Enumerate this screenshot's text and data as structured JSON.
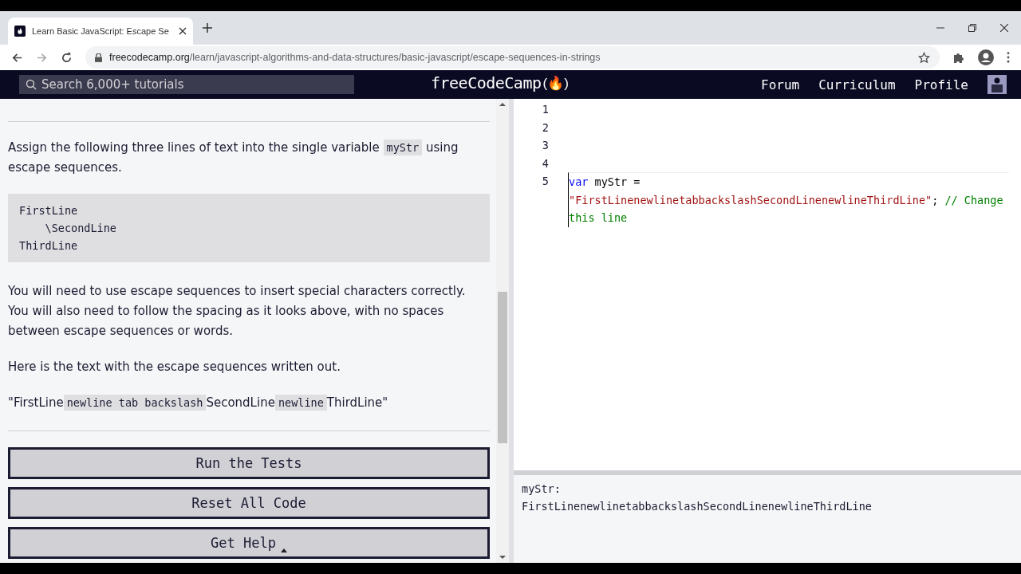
{
  "browser": {
    "tab_title": "Learn Basic JavaScript: Escape Se",
    "url_host": "freecodecamp.org",
    "url_path": "/learn/javascript-algorithms-and-data-structures/basic-javascript/escape-sequences-in-strings"
  },
  "navbar": {
    "search": {
      "placeholder": "Search 6,000+ tutorials"
    },
    "logo": "freeCodeCamp",
    "logo_mark": "(🔥)",
    "links": [
      "Forum",
      "Curriculum",
      "Profile"
    ]
  },
  "lesson": {
    "paragraphs": [
      {
        "kind": "text",
        "parts": [
          {
            "kind": "text",
            "text": "Assign the following three lines of text into the single variable "
          },
          {
            "kind": "code",
            "text": "myStr"
          },
          {
            "kind": "text",
            "text": " using escape sequences."
          }
        ]
      },
      {
        "kind": "pre",
        "lines": [
          "FirstLine",
          "    \\SecondLine",
          "ThirdLine"
        ]
      },
      {
        "kind": "text",
        "parts": [
          {
            "kind": "text",
            "text": "You will need to use escape sequences to insert special characters correctly. You will also need to follow the spacing as it looks above, with no spaces between escape sequences or words."
          }
        ]
      },
      {
        "kind": "text",
        "parts": [
          {
            "kind": "text",
            "text": "Here is the text with the escape sequences written out."
          }
        ]
      },
      {
        "kind": "text",
        "parts": [
          {
            "kind": "text",
            "text": "\"FirstLine"
          },
          {
            "kind": "code",
            "text": "newline tab backslash"
          },
          {
            "kind": "text",
            "text": "SecondLine"
          },
          {
            "kind": "code",
            "text": "newline"
          },
          {
            "kind": "text",
            "text": "ThirdLine\""
          }
        ]
      }
    ],
    "buttons": [
      {
        "label": "Run the Tests",
        "caret": false
      },
      {
        "label": "Reset All Code",
        "caret": false
      },
      {
        "label": "Get Help",
        "caret": true
      }
    ]
  },
  "editor": {
    "lines": [
      {
        "number": "1"
      },
      {
        "number": "2"
      },
      {
        "number": "3"
      },
      {
        "number": "4"
      },
      {
        "number": "5",
        "tokens": [
          {
            "kind": "keyword",
            "text": "var"
          },
          {
            "kind": "plain",
            "text": " myStr = "
          },
          {
            "kind": "string",
            "text": "\"FirstLinenewlinetabbackslashSecondLinenewlineThirdLine\""
          },
          {
            "kind": "plain",
            "text": "; "
          },
          {
            "kind": "comment",
            "text": "// Change this line"
          }
        ]
      }
    ]
  },
  "output": {
    "lines": [
      "myStr:",
      "FirstLinenewlinetabbackslashSecondLinenewlineThirdLine"
    ]
  }
}
